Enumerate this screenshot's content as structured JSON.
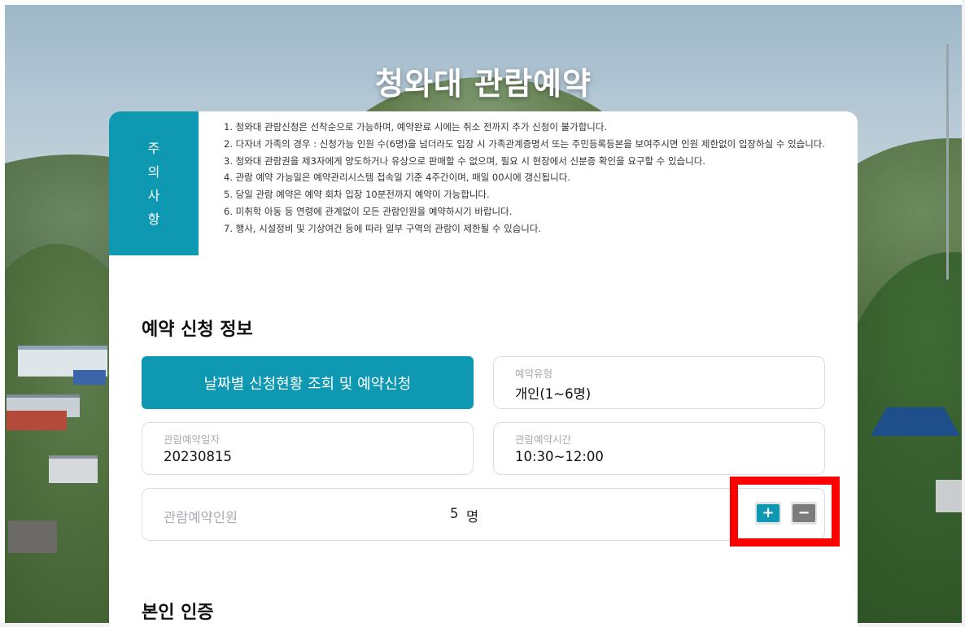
{
  "page": {
    "title": "청와대 관람예약"
  },
  "notice": {
    "label_chars": [
      "주",
      "의",
      "사",
      "항"
    ],
    "items": [
      "1. 청와대 관람신청은 선착순으로 가능하며, 예약완료 시에는 취소 전까지 추가 신청이 불가합니다.",
      "2. 다자녀 가족의 경우 : 신청가능 인원 수(6명)을 넘더라도 입장 시 가족관계증명서 또는 주민등록등본을 보여주시면 인원 제한없이 입장하실 수 있습니다.",
      "3. 청와대 관람권을 제3자에게 양도하거나 유상으로 판매할 수 없으며, 필요 시 현장에서 신분증 확인을 요구할 수 있습니다.",
      "4. 관람 예약 가능일은 예약관리시스템 접속일 기준 4주간이며, 매일 00시에 갱신됩니다.",
      "5. 당일 관람 예약은 예약 회차 입장 10분전까지 예약이 가능합니다.",
      "6. 미취학 아동 등 연령에 관계없이 모든 관람인원을 예약하시기 바랍니다.",
      "7. 행사, 시설정비 및 기상여건 등에 따라 일부 구역의 관람이 제한될 수 있습니다."
    ]
  },
  "reservation": {
    "section_title": "예약 신청 정보",
    "date_lookup_button": "날짜별 신청현황 조회 및 예약신청",
    "type": {
      "label": "예약유형",
      "value": "개인(1~6명)"
    },
    "date": {
      "label": "관람예약일자",
      "value": "20230815"
    },
    "time": {
      "label": "관람예약시간",
      "value": "10:30~12:00"
    },
    "count": {
      "label": "관람예약인원",
      "value": "5",
      "unit": "명"
    },
    "stepper": {
      "plus_symbol": "+",
      "minus_symbol": "−"
    }
  },
  "auth": {
    "section_title": "본인 인증"
  },
  "colors": {
    "accent": "#0e98b1",
    "highlight": "#ff0000",
    "minus_button": "#7c7c7c"
  }
}
